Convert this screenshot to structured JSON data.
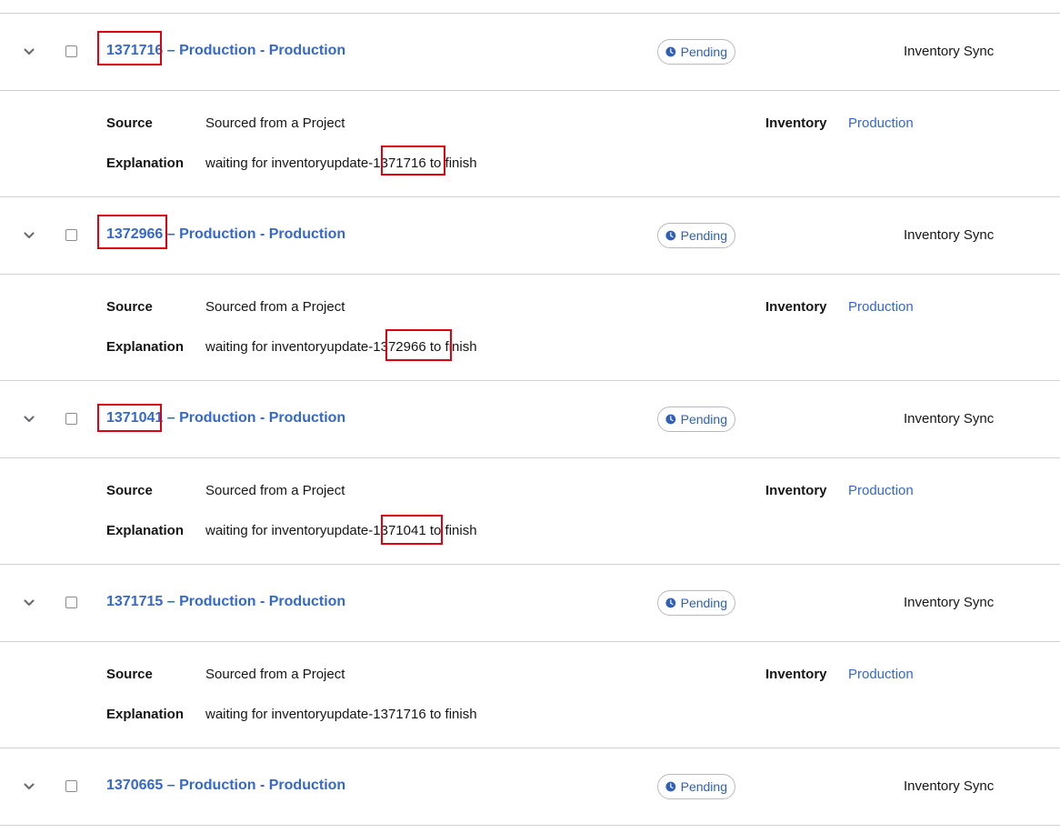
{
  "jobs": [
    {
      "id": "1371716",
      "separator": " – ",
      "name": "Production - Production",
      "status": "Pending",
      "type": "Inventory Sync",
      "details": {
        "source_label": "Source",
        "source_value": "Sourced from a Project",
        "explanation_label": "Explanation",
        "explanation_prefix": "waiting for inventoryupdate-",
        "explanation_id": "1371716",
        "explanation_suffix": " to finish",
        "inventory_label": "Inventory",
        "inventory_value": "Production"
      }
    },
    {
      "id": "1372966",
      "separator": " – ",
      "name": "Production - Production",
      "status": "Pending",
      "type": "Inventory Sync",
      "details": {
        "source_label": "Source",
        "source_value": "Sourced from a Project",
        "explanation_label": "Explanation",
        "explanation_prefix": "waiting for inventoryupdate-",
        "explanation_id": "1372966",
        "explanation_suffix": " to finish",
        "inventory_label": "Inventory",
        "inventory_value": "Production"
      }
    },
    {
      "id": "1371041",
      "separator": " – ",
      "name": "Production - Production",
      "status": "Pending",
      "type": "Inventory Sync",
      "details": {
        "source_label": "Source",
        "source_value": "Sourced from a Project",
        "explanation_label": "Explanation",
        "explanation_prefix": "waiting for inventoryupdate-",
        "explanation_id": "1371041",
        "explanation_suffix": " to finish",
        "inventory_label": "Inventory",
        "inventory_value": "Production"
      }
    },
    {
      "id": "1371715",
      "separator": " – ",
      "name": "Production - Production",
      "status": "Pending",
      "type": "Inventory Sync",
      "details": {
        "source_label": "Source",
        "source_value": "Sourced from a Project",
        "explanation_label": "Explanation",
        "explanation_prefix": "waiting for inventoryupdate-",
        "explanation_id": "1371716",
        "explanation_suffix": " to finish",
        "inventory_label": "Inventory",
        "inventory_value": "Production"
      }
    },
    {
      "id": "1370665",
      "separator": " – ",
      "name": "Production - Production",
      "status": "Pending",
      "type": "Inventory Sync"
    }
  ],
  "colors": {
    "link": "#3568c8",
    "highlight": "#e0000f",
    "border": "#d2d2d2",
    "status": "#2f5fb8"
  },
  "icons": {
    "expand": "chevron-down-icon",
    "status": "clock-icon"
  }
}
